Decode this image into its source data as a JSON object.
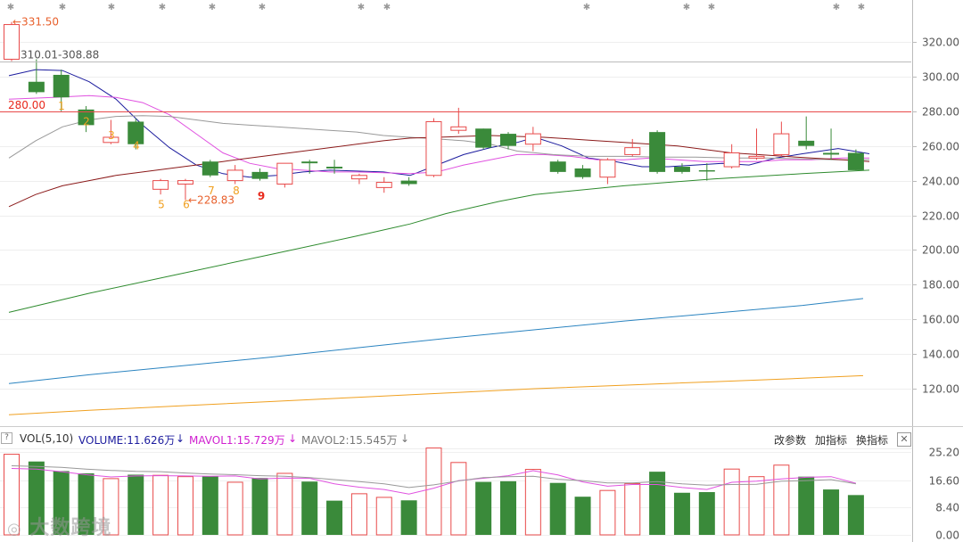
{
  "chart_data": {
    "type": "candlestick",
    "price_axis": {
      "min": 100,
      "max": 330,
      "ticks": [
        "320.00",
        "300.00",
        "280.00",
        "260.00",
        "240.00",
        "220.00",
        "200.00",
        "180.00",
        "160.00",
        "140.00",
        "120.00"
      ]
    },
    "volume_axis": {
      "min": 0,
      "max": 27.5,
      "ticks": [
        "25.20",
        "16.60",
        "8.40",
        "0.00"
      ]
    },
    "candles": [
      {
        "o": 310.0,
        "h": 331.5,
        "l": 308.9,
        "c": 330.0,
        "v": 24.5,
        "up": true
      },
      {
        "o": 297.0,
        "h": 310.0,
        "l": 290.0,
        "c": 291.0,
        "v": 22.3,
        "up": false
      },
      {
        "o": 301.0,
        "h": 304.0,
        "l": 280.0,
        "c": 288.0,
        "v": 19.4,
        "up": false
      },
      {
        "o": 281.0,
        "h": 283.0,
        "l": 268.0,
        "c": 272.0,
        "v": 18.7,
        "up": false
      },
      {
        "o": 262.0,
        "h": 275.0,
        "l": 261.0,
        "c": 265.0,
        "v": 17.1,
        "up": true
      },
      {
        "o": 274.0,
        "h": 276.0,
        "l": 258.0,
        "c": 261.0,
        "v": 18.3,
        "up": false
      },
      {
        "o": 235.0,
        "h": 241.0,
        "l": 232.0,
        "c": 240.0,
        "v": 18.1,
        "up": true
      },
      {
        "o": 238.0,
        "h": 241.0,
        "l": 228.83,
        "c": 240.0,
        "v": 17.7,
        "up": true
      },
      {
        "o": 251.0,
        "h": 252.0,
        "l": 242.0,
        "c": 243.0,
        "v": 17.8,
        "up": false
      },
      {
        "o": 240.0,
        "h": 249.0,
        "l": 238.0,
        "c": 246.0,
        "v": 16.0,
        "up": true
      },
      {
        "o": 245.0,
        "h": 247.0,
        "l": 240.0,
        "c": 241.0,
        "v": 17.3,
        "up": false
      },
      {
        "o": 238.0,
        "h": 250.0,
        "l": 236.0,
        "c": 250.0,
        "v": 18.7,
        "up": true
      },
      {
        "o": 250.0,
        "h": 252.0,
        "l": 244.0,
        "c": 251.0,
        "v": 16.2,
        "up": false
      },
      {
        "o": 247.0,
        "h": 252.0,
        "l": 244.0,
        "c": 248.0,
        "v": 10.4,
        "up": false
      },
      {
        "o": 241.0,
        "h": 244.0,
        "l": 238.0,
        "c": 243.0,
        "v": 12.5,
        "up": true
      },
      {
        "o": 236.0,
        "h": 242.0,
        "l": 233.0,
        "c": 239.0,
        "v": 11.4,
        "up": true
      },
      {
        "o": 240.0,
        "h": 242.0,
        "l": 237.0,
        "c": 238.0,
        "v": 10.5,
        "up": false
      },
      {
        "o": 243.0,
        "h": 276.0,
        "l": 242.0,
        "c": 274.0,
        "v": 26.4,
        "up": true
      },
      {
        "o": 269.0,
        "h": 282.0,
        "l": 267.0,
        "c": 271.0,
        "v": 22.0,
        "up": true
      },
      {
        "o": 270.0,
        "h": 270.0,
        "l": 258.0,
        "c": 259.0,
        "v": 16.1,
        "up": false
      },
      {
        "o": 267.0,
        "h": 268.0,
        "l": 258.0,
        "c": 260.0,
        "v": 16.3,
        "up": false
      },
      {
        "o": 261.0,
        "h": 271.0,
        "l": 257.0,
        "c": 267.0,
        "v": 19.9,
        "up": true
      },
      {
        "o": 251.0,
        "h": 252.0,
        "l": 244.0,
        "c": 245.0,
        "v": 15.8,
        "up": false
      },
      {
        "o": 247.0,
        "h": 249.0,
        "l": 241.0,
        "c": 242.0,
        "v": 11.6,
        "up": false
      },
      {
        "o": 242.0,
        "h": 253.0,
        "l": 238.0,
        "c": 252.0,
        "v": 13.5,
        "up": true
      },
      {
        "o": 255.0,
        "h": 264.0,
        "l": 254.0,
        "c": 259.0,
        "v": 15.6,
        "up": true
      },
      {
        "o": 268.0,
        "h": 269.0,
        "l": 244.0,
        "c": 245.0,
        "v": 19.2,
        "up": false
      },
      {
        "o": 248.0,
        "h": 250.0,
        "l": 244.0,
        "c": 245.0,
        "v": 12.8,
        "up": false
      },
      {
        "o": 246.0,
        "h": 250.0,
        "l": 240.0,
        "c": 246.0,
        "v": 13.0,
        "up": false
      },
      {
        "o": 248.0,
        "h": 261.0,
        "l": 247.0,
        "c": 256.0,
        "v": 20.0,
        "up": true
      },
      {
        "o": 253.0,
        "h": 270.0,
        "l": 252.0,
        "c": 254.0,
        "v": 17.7,
        "up": true
      },
      {
        "o": 255.0,
        "h": 274.0,
        "l": 254.0,
        "c": 267.0,
        "v": 21.2,
        "up": true
      },
      {
        "o": 263.0,
        "h": 277.0,
        "l": 258.0,
        "c": 260.0,
        "v": 17.7,
        "up": false
      },
      {
        "o": 256.0,
        "h": 270.0,
        "l": 252.0,
        "c": 255.0,
        "v": 13.8,
        "up": false
      },
      {
        "o": 256.0,
        "h": 258.0,
        "l": 246.0,
        "c": 246.0,
        "v": 12.1,
        "up": false
      }
    ],
    "lines": [
      {
        "name": "ma5",
        "color": "#1c1c9e",
        "points": [
          [
            10,
            300.5
          ],
          [
            40,
            304
          ],
          [
            70,
            303.5
          ],
          [
            100,
            297
          ],
          [
            130,
            287
          ],
          [
            160,
            272
          ],
          [
            190,
            259
          ],
          [
            220,
            249
          ],
          [
            250,
            244
          ],
          [
            280,
            242
          ],
          [
            310,
            243
          ],
          [
            340,
            245
          ],
          [
            370,
            246
          ],
          [
            400,
            245.5
          ],
          [
            430,
            245
          ],
          [
            460,
            243
          ],
          [
            490,
            249
          ],
          [
            520,
            255
          ],
          [
            550,
            259
          ],
          [
            580,
            262
          ],
          [
            600,
            265
          ],
          [
            630,
            260
          ],
          [
            660,
            253
          ],
          [
            690,
            251
          ],
          [
            720,
            248
          ],
          [
            750,
            248
          ],
          [
            780,
            249
          ],
          [
            810,
            250
          ],
          [
            840,
            249
          ],
          [
            870,
            253
          ],
          [
            900,
            255.5
          ],
          [
            940,
            258.5
          ],
          [
            975,
            255.5
          ]
        ]
      },
      {
        "name": "ma10",
        "color": "#e052e0",
        "points": [
          [
            10,
            287
          ],
          [
            60,
            288
          ],
          [
            100,
            289
          ],
          [
            130,
            288
          ],
          [
            160,
            285
          ],
          [
            190,
            278
          ],
          [
            220,
            267
          ],
          [
            250,
            256
          ],
          [
            280,
            250
          ],
          [
            310,
            247
          ],
          [
            340,
            246
          ],
          [
            370,
            245
          ],
          [
            400,
            245
          ],
          [
            430,
            244.5
          ],
          [
            460,
            244
          ],
          [
            490,
            245
          ],
          [
            520,
            249
          ],
          [
            550,
            252
          ],
          [
            580,
            255
          ],
          [
            610,
            255
          ],
          [
            640,
            254
          ],
          [
            670,
            252
          ],
          [
            700,
            252
          ],
          [
            730,
            253
          ],
          [
            760,
            252
          ],
          [
            790,
            251
          ],
          [
            820,
            251
          ],
          [
            850,
            251
          ],
          [
            880,
            252
          ],
          [
            910,
            252
          ],
          [
            945,
            253
          ],
          [
            975,
            253
          ]
        ]
      },
      {
        "name": "ma20",
        "color": "#999999",
        "points": [
          [
            10,
            253
          ],
          [
            40,
            263
          ],
          [
            70,
            271
          ],
          [
            100,
            275
          ],
          [
            130,
            277
          ],
          [
            160,
            277.5
          ],
          [
            190,
            277
          ],
          [
            220,
            275
          ],
          [
            250,
            273
          ],
          [
            280,
            272
          ],
          [
            310,
            271
          ],
          [
            340,
            270
          ],
          [
            370,
            269
          ],
          [
            400,
            268
          ],
          [
            430,
            266
          ],
          [
            460,
            265
          ],
          [
            490,
            264
          ],
          [
            520,
            263
          ],
          [
            550,
            261
          ],
          [
            580,
            257
          ],
          [
            620,
            255
          ],
          [
            660,
            254
          ],
          [
            700,
            254
          ],
          [
            740,
            253.5
          ],
          [
            780,
            253.5
          ],
          [
            820,
            253
          ],
          [
            860,
            253
          ],
          [
            900,
            252.5
          ],
          [
            940,
            252
          ],
          [
            975,
            252
          ]
        ]
      },
      {
        "name": "ma30",
        "color": "#8b1a1a",
        "points": [
          [
            10,
            225
          ],
          [
            40,
            232
          ],
          [
            70,
            237
          ],
          [
            100,
            240
          ],
          [
            130,
            243
          ],
          [
            160,
            245
          ],
          [
            190,
            247
          ],
          [
            220,
            249
          ],
          [
            250,
            251
          ],
          [
            280,
            253
          ],
          [
            310,
            255
          ],
          [
            340,
            257
          ],
          [
            370,
            259
          ],
          [
            400,
            261
          ],
          [
            430,
            263
          ],
          [
            460,
            264.5
          ],
          [
            490,
            265
          ],
          [
            520,
            265.5
          ],
          [
            550,
            266
          ],
          [
            580,
            265.5
          ],
          [
            610,
            265
          ],
          [
            640,
            264
          ],
          [
            670,
            263
          ],
          [
            700,
            262
          ],
          [
            730,
            261
          ],
          [
            760,
            260
          ],
          [
            790,
            258
          ],
          [
            820,
            256
          ],
          [
            850,
            255
          ],
          [
            880,
            254
          ],
          [
            910,
            253
          ],
          [
            945,
            252
          ],
          [
            975,
            251
          ]
        ]
      },
      {
        "name": "ma60",
        "color": "#2e8b2e",
        "points": [
          [
            10,
            164
          ],
          [
            100,
            175
          ],
          [
            200,
            186
          ],
          [
            300,
            197
          ],
          [
            400,
            208
          ],
          [
            460,
            215
          ],
          [
            500,
            221
          ],
          [
            560,
            228
          ],
          [
            600,
            232
          ],
          [
            700,
            237
          ],
          [
            800,
            241
          ],
          [
            900,
            244
          ],
          [
            975,
            246
          ]
        ]
      },
      {
        "name": "ma120",
        "color": "#2b84c0",
        "points": [
          [
            10,
            123
          ],
          [
            100,
            128
          ],
          [
            200,
            133
          ],
          [
            300,
            138
          ],
          [
            400,
            143.5
          ],
          [
            500,
            149
          ],
          [
            600,
            154
          ],
          [
            700,
            159
          ],
          [
            800,
            163.5
          ],
          [
            900,
            168
          ],
          [
            968,
            172
          ]
        ]
      },
      {
        "name": "ma250",
        "color": "#f0a020",
        "points": [
          [
            10,
            105
          ],
          [
            100,
            107.5
          ],
          [
            200,
            110
          ],
          [
            300,
            112.5
          ],
          [
            400,
            115
          ],
          [
            500,
            117.5
          ],
          [
            600,
            120
          ],
          [
            700,
            122
          ],
          [
            800,
            124
          ],
          [
            900,
            126
          ],
          [
            968,
            127.5
          ]
        ]
      }
    ],
    "vol_lines": [
      {
        "name": "MAVOL1",
        "color": "#e052e0",
        "values": [
          20.2,
          20.0,
          19.2,
          18.3,
          17.6,
          17.9,
          18.0,
          17.9,
          17.8,
          17.9,
          17.0,
          17.3,
          17.2,
          15.5,
          14.5,
          13.8,
          12.4,
          14.2,
          16.5,
          17.2,
          18.0,
          19.5,
          18.2,
          16.1,
          14.8,
          15.3,
          15.3,
          14.4,
          13.8,
          16.0,
          16.3,
          17.0,
          17.5,
          17.7,
          15.7
        ]
      },
      {
        "name": "MAVOL2",
        "color": "#999999",
        "values": [
          21.0,
          20.8,
          20.5,
          20.0,
          19.6,
          19.3,
          19.2,
          18.8,
          18.5,
          18.3,
          18.0,
          17.8,
          17.4,
          16.8,
          16.2,
          15.5,
          14.4,
          15.2,
          16.4,
          17.4,
          17.7,
          17.8,
          16.9,
          16.5,
          15.8,
          15.8,
          16.2,
          15.5,
          15.1,
          15.3,
          15.4,
          16.3,
          16.5,
          16.8,
          15.5
        ]
      }
    ],
    "levels": {
      "high_label": "331.50",
      "range_label": "310.01-308.88",
      "level_label": "280.00",
      "low_label": "228.83"
    },
    "counts": [
      {
        "text": "1",
        "color": "#f0a020"
      },
      {
        "text": "2",
        "color": "#f0a020"
      },
      {
        "text": "3",
        "color": "#f0a020"
      },
      {
        "text": "4",
        "color": "#f0a020"
      },
      {
        "text": "5",
        "color": "#f0a020"
      },
      {
        "text": "6",
        "color": "#f0a020"
      },
      {
        "text": "7",
        "color": "#f0a020"
      },
      {
        "text": "8",
        "color": "#f0a020"
      },
      {
        "text": "9",
        "color": "#e8291c"
      }
    ]
  },
  "volume_header": {
    "title": "VOL(5,10)",
    "volume": "VOLUME:11.626万",
    "mavol1": "MAVOL1:15.729万",
    "mavol2": "MAVOL2:15.545万",
    "btn_params": "改参数",
    "btn_add": "加指标",
    "btn_switch": "换指标",
    "close": "✕",
    "collapse": "?"
  },
  "watermark": "大数跨境",
  "colors": {
    "up": "#e84a4a",
    "down": "#3a8a3a"
  }
}
